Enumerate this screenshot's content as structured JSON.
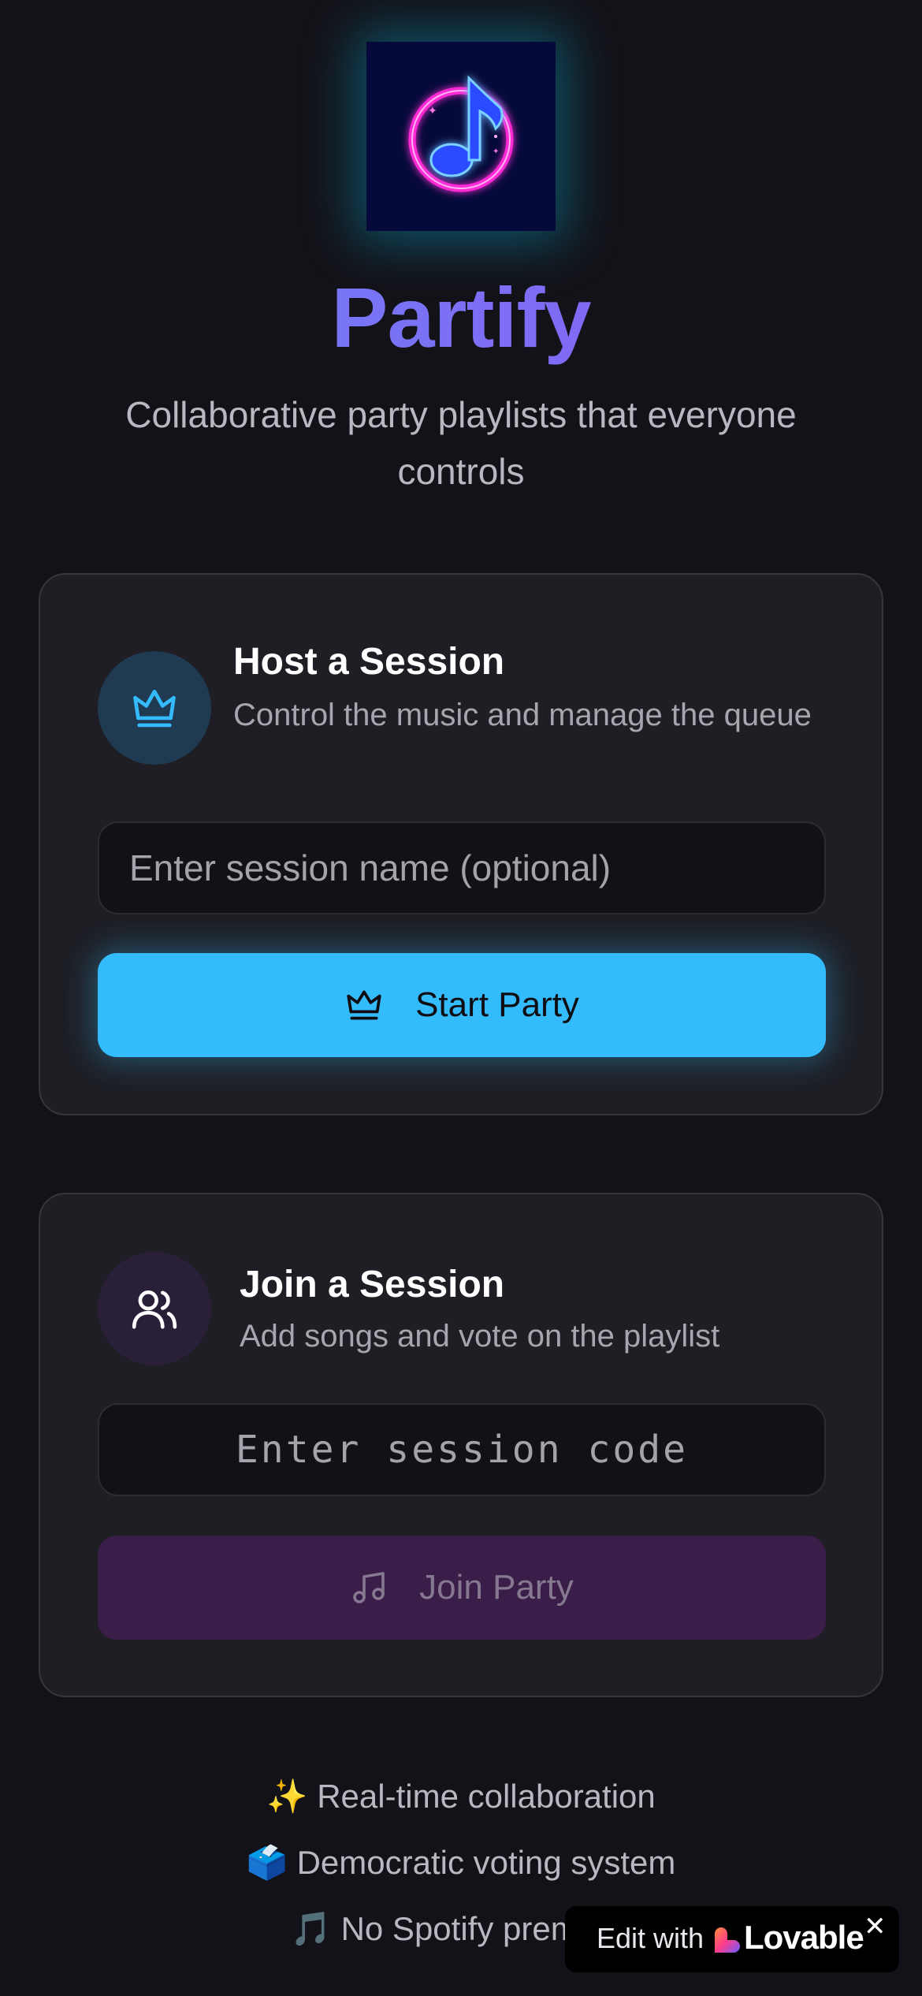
{
  "app": {
    "title": "Partify",
    "subtitle": "Collaborative party playlists that everyone controls",
    "logo_icon": "music-note-icon"
  },
  "host": {
    "title": "Host a Session",
    "description": "Control the music and manage the queue",
    "icon": "crown-icon",
    "input_placeholder": "Enter session name (optional)",
    "button_label": "Start Party",
    "button_icon": "crown-icon",
    "accent": "#34bbfc"
  },
  "join": {
    "title": "Join a Session",
    "description": "Add songs and vote on the playlist",
    "icon": "users-icon",
    "input_placeholder": "Enter session code",
    "button_label": "Join Party",
    "button_icon": "music-note-icon",
    "accent": "#3a1d48"
  },
  "features": [
    "✨ Real-time collaboration",
    "🗳️ Democratic voting system",
    "🎵 No Spotify premium"
  ],
  "badge": {
    "prefix": "Edit with",
    "brand": "Lovable",
    "close": "✕"
  }
}
